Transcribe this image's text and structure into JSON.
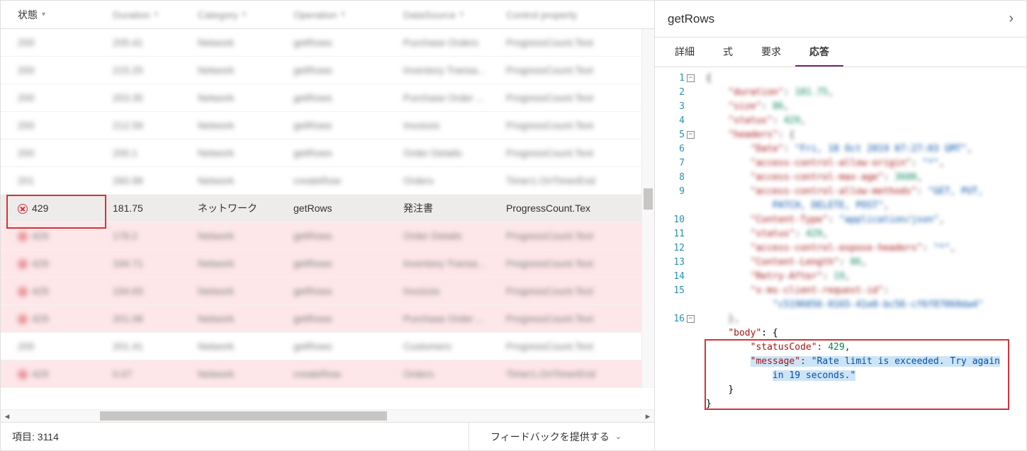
{
  "table": {
    "columns": {
      "status": "状態",
      "duration": "Duration",
      "category": "Category",
      "operation": "Operation",
      "datasource": "DataSource",
      "control": "Control property"
    },
    "rows": [
      {
        "status": "200",
        "duration": "205.41",
        "category": "Network",
        "operation": "getRows",
        "datasource": "Purchase Orders",
        "control": "ProgressCount.Text",
        "err": false,
        "hl": false,
        "blur": true
      },
      {
        "status": "200",
        "duration": "215.25",
        "category": "Network",
        "operation": "getRows",
        "datasource": "Inventory Transa...",
        "control": "ProgressCount.Text",
        "err": false,
        "hl": false,
        "blur": true
      },
      {
        "status": "200",
        "duration": "203.35",
        "category": "Network",
        "operation": "getRows",
        "datasource": "Purchase Order ...",
        "control": "ProgressCount.Text",
        "err": false,
        "hl": false,
        "blur": true
      },
      {
        "status": "200",
        "duration": "212.59",
        "category": "Network",
        "operation": "getRows",
        "datasource": "Invoices",
        "control": "ProgressCount.Text",
        "err": false,
        "hl": false,
        "blur": true
      },
      {
        "status": "200",
        "duration": "200.1",
        "category": "Network",
        "operation": "getRows",
        "datasource": "Order Details",
        "control": "ProgressCount.Text",
        "err": false,
        "hl": false,
        "blur": true
      },
      {
        "status": "201",
        "duration": "260.98",
        "category": "Network",
        "operation": "createRow",
        "datasource": "Orders",
        "control": "Timer1.OnTimerEnd",
        "err": false,
        "hl": false,
        "blur": true
      },
      {
        "status": "429",
        "duration": "181.75",
        "category": "ネットワーク",
        "operation": "getRows",
        "datasource": "発注書",
        "control": "ProgressCount.Tex",
        "err": true,
        "hl": true,
        "blur": false
      },
      {
        "status": "429",
        "duration": "178.2",
        "category": "Network",
        "operation": "getRows",
        "datasource": "Order Details",
        "control": "ProgressCount.Text",
        "err": true,
        "hl": false,
        "blur": true
      },
      {
        "status": "429",
        "duration": "194.71",
        "category": "Network",
        "operation": "getRows",
        "datasource": "Inventory Transa...",
        "control": "ProgressCount.Text",
        "err": true,
        "hl": false,
        "blur": true
      },
      {
        "status": "429",
        "duration": "194.83",
        "category": "Network",
        "operation": "getRows",
        "datasource": "Invoices",
        "control": "ProgressCount.Text",
        "err": true,
        "hl": false,
        "blur": true
      },
      {
        "status": "429",
        "duration": "201.08",
        "category": "Network",
        "operation": "getRows",
        "datasource": "Purchase Order ...",
        "control": "ProgressCount.Text",
        "err": true,
        "hl": false,
        "blur": true
      },
      {
        "status": "200",
        "duration": "201.41",
        "category": "Network",
        "operation": "getRows",
        "datasource": "Customers",
        "control": "ProgressCount.Text",
        "err": false,
        "hl": false,
        "blur": true
      },
      {
        "status": "429",
        "duration": "0.07",
        "category": "Network",
        "operation": "createRow",
        "datasource": "Orders",
        "control": "Timer1.OnTimerEnd",
        "err": true,
        "hl": false,
        "blur": true
      }
    ],
    "itemCountLabel": "項目: 3114",
    "feedbackLabel": "フィードバックを提供する"
  },
  "rightPanel": {
    "title": "getRows",
    "tabs": {
      "detail": "詳細",
      "formula": "式",
      "request": "要求",
      "response": "応答"
    },
    "activeTab": "response",
    "json": {
      "lineNumbers": [
        "1",
        "2",
        "3",
        "4",
        "5",
        "6",
        "7",
        "8",
        "9",
        "",
        "10",
        "11",
        "12",
        "13",
        "14",
        "15",
        "",
        "16",
        "",
        "",
        "",
        "",
        "",
        ""
      ],
      "body_key": "\"body\"",
      "statusCode_key": "\"statusCode\"",
      "statusCode_val": "429",
      "message_key": "\"message\"",
      "message_val1": "\"Rate limit is exceeded. Try again",
      "message_val2": "in 19 seconds.\""
    }
  }
}
